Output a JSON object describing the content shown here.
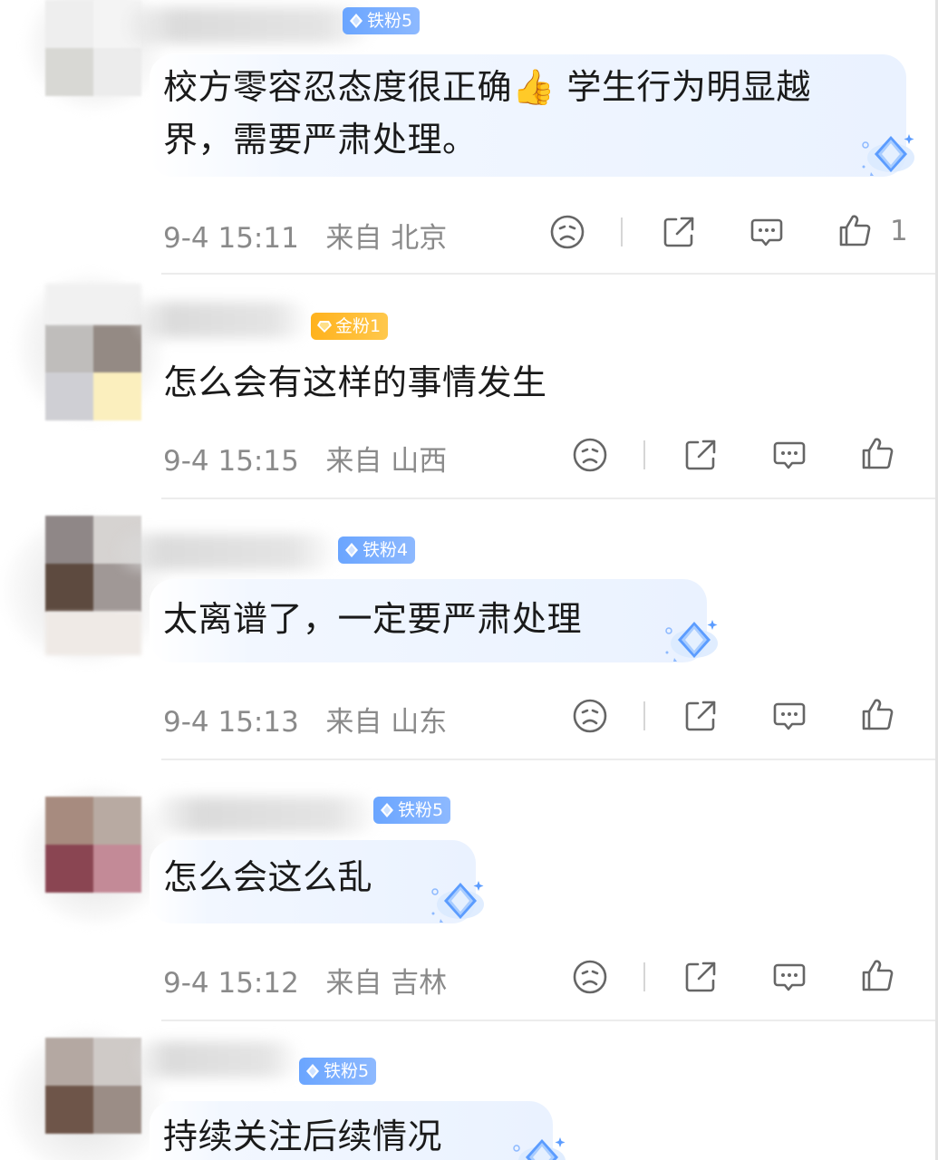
{
  "comments": [
    {
      "badge": "铁粉5",
      "badge_type": "blue",
      "text_line1": "校方零容忍态度很正确👍 学生行为明显越",
      "text_line2": "界，需要严肃处理。",
      "time": "9-4 15:11",
      "location": "来自 北京",
      "likes": "1"
    },
    {
      "badge": "金粉1",
      "badge_type": "gold",
      "text_line1": "怎么会有这样的事情发生",
      "time": "9-4 15:15",
      "location": "来自 山西",
      "likes": ""
    },
    {
      "badge": "铁粉4",
      "badge_type": "blue",
      "text_line1": "太离谱了，一定要严肃处理",
      "time": "9-4 15:13",
      "location": "来自 山东",
      "likes": ""
    },
    {
      "badge": "铁粉5",
      "badge_type": "blue",
      "text_line1": "怎么会这么乱",
      "time": "9-4 15:12",
      "location": "来自 吉林",
      "likes": ""
    },
    {
      "badge": "铁粉5",
      "badge_type": "blue",
      "text_line1": "持续关注后续情况",
      "time": "",
      "location": "",
      "likes": ""
    }
  ],
  "colors": {
    "badge_blue": "#6aa5ff",
    "badge_gold": "#ffb21d",
    "meta_text": "#8a8a8a",
    "comment_text": "#1a1a1a",
    "bubble_tint": "#eaf2ff"
  },
  "icons": {
    "dislike": "sad-face-icon",
    "share": "share-icon",
    "reply": "comment-icon",
    "like": "thumbs-up-icon"
  }
}
